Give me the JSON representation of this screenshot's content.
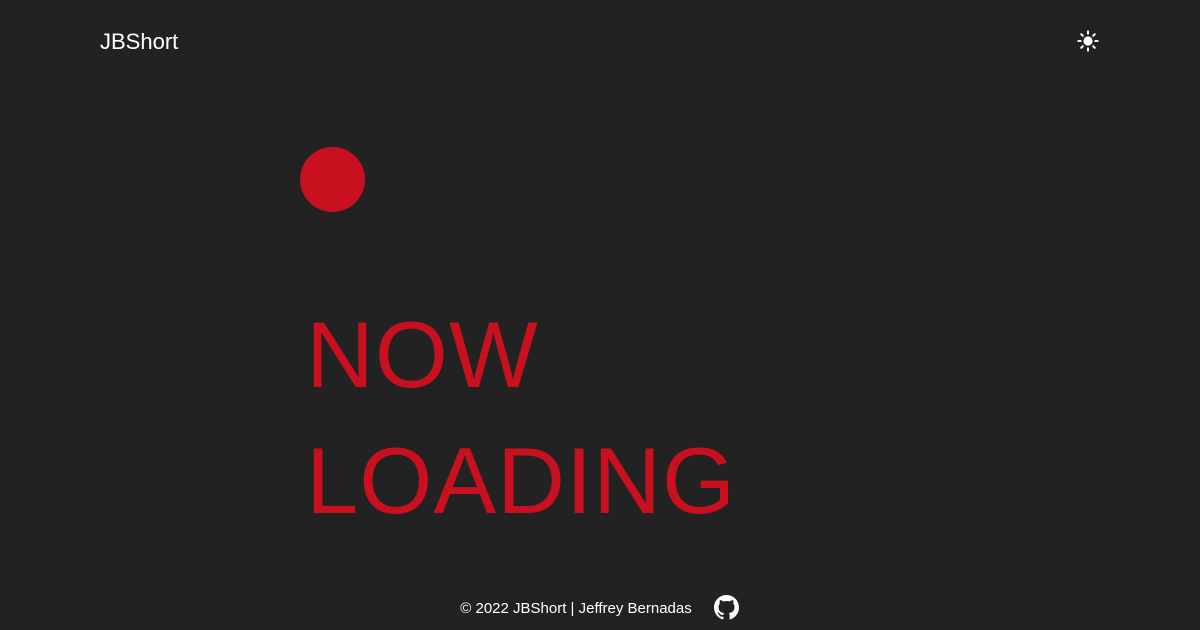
{
  "header": {
    "brand": "JBShort",
    "theme_toggle_icon": "sun-icon"
  },
  "loader": {
    "line1": "NOW",
    "line2": "LOADING",
    "dot_icon": "loading-dot"
  },
  "footer": {
    "copyright": "© 2022 JBShort | Jeffrey Bernadas",
    "github_icon": "github-icon"
  },
  "colors": {
    "background": "#222222",
    "accent": "#c8101e",
    "text": "#ffffff"
  }
}
